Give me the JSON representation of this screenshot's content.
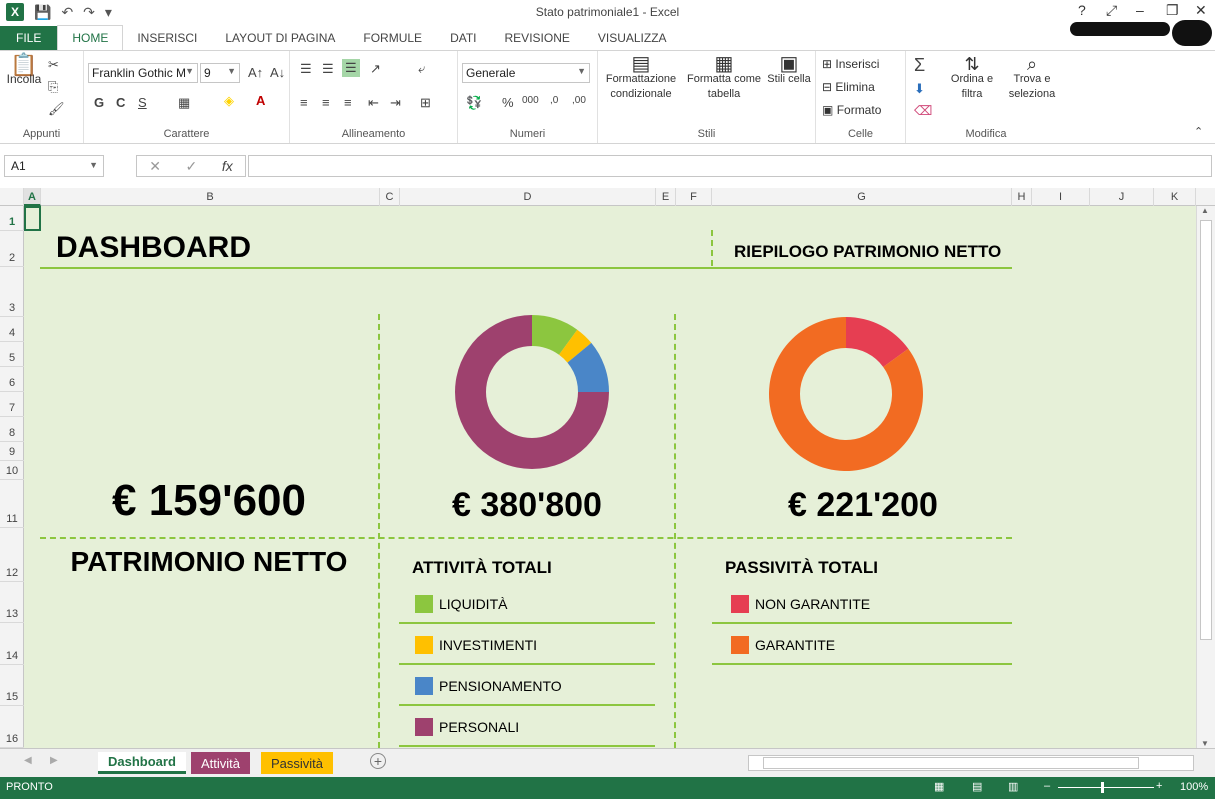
{
  "window": {
    "title": "Stato patrimoniale1 - Excel",
    "help": "?",
    "minimize": "–",
    "restore": "❐",
    "close": "✕"
  },
  "ribbon_tabs": [
    "FILE",
    "HOME",
    "INSERISCI",
    "LAYOUT DI PAGINA",
    "FORMULE",
    "DATI",
    "REVISIONE",
    "VISUALIZZA"
  ],
  "ribbon": {
    "clipboard": {
      "label": "Appunti",
      "paste": "Incolla"
    },
    "font": {
      "label": "Carattere",
      "font_name": "Franklin Gothic M",
      "font_size": "9",
      "bold": "G",
      "italic": "C",
      "underline": "S"
    },
    "alignment": {
      "label": "Allineamento"
    },
    "number": {
      "label": "Numeri",
      "format": "Generale"
    },
    "styles": {
      "label": "Stili",
      "conditional": "Formattazione condizionale",
      "table": "Formatta come tabella",
      "cell_styles": "Stili cella"
    },
    "cells": {
      "label": "Celle",
      "insert": "Inserisci",
      "delete": "Elimina",
      "format": "Formato"
    },
    "editing": {
      "label": "Modifica",
      "sort": "Ordina e filtra",
      "find": "Trova e seleziona"
    }
  },
  "formula_bar": {
    "name_box": "A1",
    "fx": "fx",
    "cancel": "✕",
    "enter": "✓",
    "value": ""
  },
  "columns": [
    "A",
    "B",
    "C",
    "D",
    "E",
    "F",
    "G",
    "H",
    "I",
    "J",
    "K"
  ],
  "rows": [
    "1",
    "2",
    "3",
    "4",
    "5",
    "6",
    "7",
    "8",
    "9",
    "10",
    "11",
    "12",
    "13",
    "14",
    "15",
    "16"
  ],
  "dashboard": {
    "title": "DASHBOARD",
    "summary_title": "RIEPILOGO PATRIMONIO NETTO",
    "net_worth_value": "€ 159'600",
    "net_worth_label": "PATRIMONIO NETTO",
    "assets_value": "€ 380'800",
    "assets_label": "ATTIVITÀ TOTALI",
    "liabilities_value": "€ 221'200",
    "liabilities_label": "PASSIVITÀ TOTALI",
    "colors": {
      "liquidita": "#8cc63f",
      "investimenti": "#ffc000",
      "pensionamento": "#4a86c8",
      "personali": "#9e416e",
      "non_garantite": "#e63e52",
      "garantite": "#f26b22",
      "accent_line": "#8cc63f",
      "sheet_bg": "#e6f0d8"
    }
  },
  "chart_data": [
    {
      "type": "pie",
      "categories": [
        "LIQUIDITÀ",
        "INVESTIMENTI",
        "PENSIONAMENTO",
        "PERSONALI"
      ],
      "values": [
        0.1,
        0.04,
        0.11,
        0.75
      ],
      "colors": [
        "#8cc63f",
        "#ffc000",
        "#4a86c8",
        "#9e416e"
      ]
    },
    {
      "type": "pie",
      "categories": [
        "NON GARANTITE",
        "GARANTITE"
      ],
      "values": [
        0.15,
        0.85
      ],
      "colors": [
        "#e63e52",
        "#f26b22"
      ]
    }
  ],
  "sheet_tabs": [
    {
      "label": "Dashboard",
      "color": "#217346"
    },
    {
      "label": "Attività",
      "color": "#9e416e"
    },
    {
      "label": "Passività",
      "color": "#ffc000"
    }
  ],
  "status": {
    "mode": "PRONTO",
    "zoom": "100%"
  }
}
